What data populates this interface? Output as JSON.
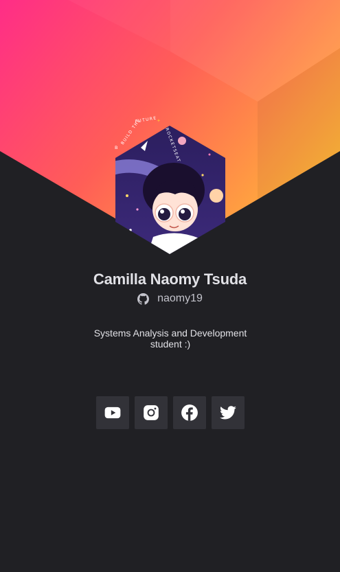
{
  "profile": {
    "name": "Camilla Naomy Tsuda",
    "username": "naomy19",
    "bio": "Systems Analysis and Development student :)",
    "avatar_badge_text": "BUILD THE FUTURE · ROCKETSEAT"
  },
  "socials": [
    {
      "name": "YouTube",
      "icon": "youtube-icon"
    },
    {
      "name": "Instagram",
      "icon": "instagram-icon"
    },
    {
      "name": "Facebook",
      "icon": "facebook-icon"
    },
    {
      "name": "Twitter",
      "icon": "twitter-icon"
    }
  ],
  "colors": {
    "background": "#202024",
    "gradient_start": "#ff2d87",
    "gradient_mid": "#ff5e57",
    "gradient_end": "#ffb13b",
    "button_bg": "#323238",
    "text_primary": "#e1e1e6",
    "text_secondary": "#c4c4cc"
  }
}
